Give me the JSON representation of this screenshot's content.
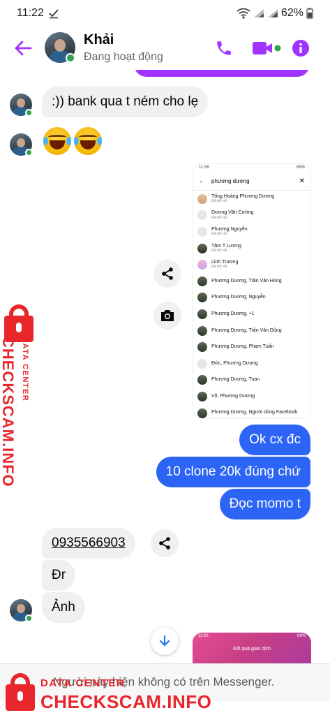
{
  "status_bar": {
    "time": "11:22",
    "battery": "62%"
  },
  "header": {
    "contact_name": "Khải",
    "contact_status": "Đang hoạt động"
  },
  "colors": {
    "accent": "#a033ff",
    "outgoing_bubble": "#2c64f6",
    "online": "#31a24c",
    "watermark": "#e8262b"
  },
  "messages": {
    "in_1": ":)) bank qua t ném cho lẹ",
    "in_emoji": "🤣🤣",
    "out_1": "Ok cx đc",
    "out_2": "10 clone 20k đúng chứ",
    "out_3": "Đọc momo t",
    "in_phone": "0935566903",
    "in_2": "Đr",
    "in_3": "Ảnh"
  },
  "shared_image": {
    "status_time": "11:58",
    "status_right": "69%",
    "search_query": "phương dương",
    "results": [
      {
        "name": "Tống Hoàng Phương Dương",
        "sub": "Đã kết nối"
      },
      {
        "name": "Dương Văn Cường",
        "sub": "Đã kết nối"
      },
      {
        "name": "Phương Nguyễn",
        "sub": "Đã kết nối"
      },
      {
        "name": "Tâm T Lương",
        "sub": "Đã kết nối"
      },
      {
        "name": "Linh Trương",
        "sub": "Đã kết nối"
      },
      {
        "name": "Phương Dương, Trần Văn Hùng",
        "sub": ""
      },
      {
        "name": "Phương Dương, Nguyễn",
        "sub": ""
      },
      {
        "name": "Phương Dương, +1",
        "sub": ""
      },
      {
        "name": "Phương Dương, Trần Văn Dũng",
        "sub": ""
      },
      {
        "name": "Phương Dương, Phạm Tuấn",
        "sub": ""
      },
      {
        "name": "Đức, Phương Dương",
        "sub": ""
      },
      {
        "name": "Phương Dương, Tuan",
        "sub": ""
      },
      {
        "name": "Võ, Phương Dương",
        "sub": ""
      },
      {
        "name": "Phương Dương, Người dùng Facebook",
        "sub": ""
      }
    ]
  },
  "shared_image_2": {
    "status_time": "11:00",
    "status_right": "69%",
    "title": "Kết quả giao dịch"
  },
  "footer": {
    "notice": "Người này hiện không có trên Messenger."
  },
  "watermark": {
    "small": "DATA CENTER",
    "big": "CHECKSCAM.INFO"
  }
}
